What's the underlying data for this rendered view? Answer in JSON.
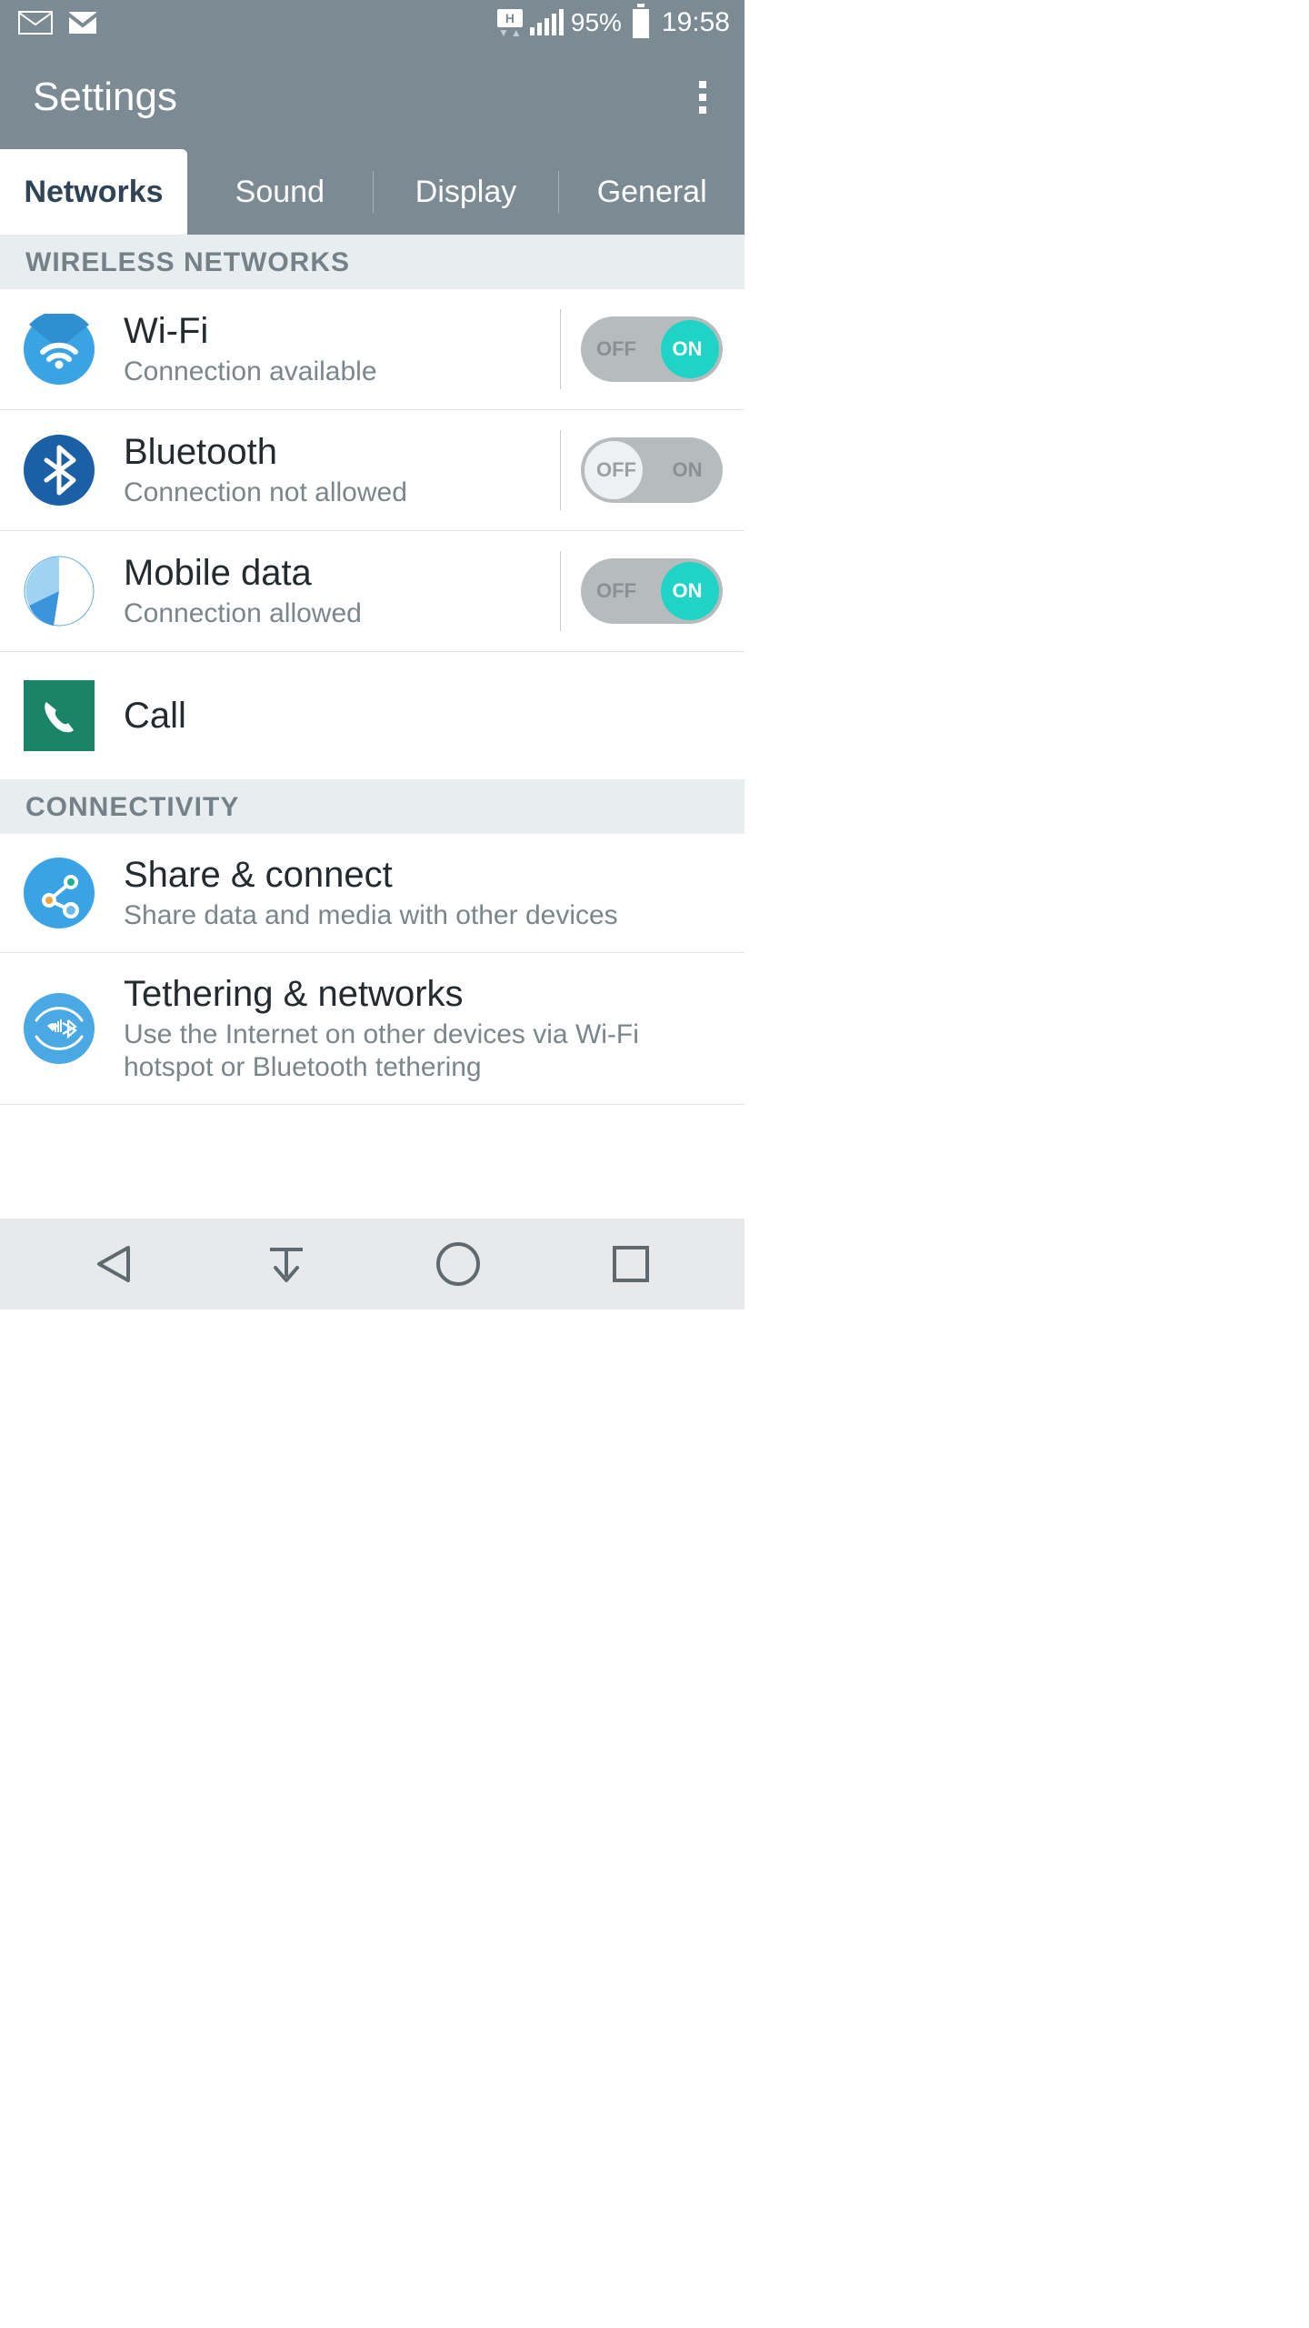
{
  "status": {
    "network_badge": "H",
    "battery_pct": "95%",
    "time": "19:58"
  },
  "header": {
    "title": "Settings"
  },
  "tabs": {
    "networks": "Networks",
    "sound": "Sound",
    "display": "Display",
    "general": "General"
  },
  "sections": {
    "wireless": "WIRELESS NETWORKS",
    "connectivity": "CONNECTIVITY"
  },
  "toggle_labels": {
    "off": "OFF",
    "on": "ON"
  },
  "items": {
    "wifi": {
      "title": "Wi-Fi",
      "sub": "Connection available",
      "on": true
    },
    "bluetooth": {
      "title": "Bluetooth",
      "sub": "Connection not allowed",
      "on": false
    },
    "mobiledata": {
      "title": "Mobile data",
      "sub": "Connection allowed",
      "on": true
    },
    "call": {
      "title": "Call"
    },
    "share": {
      "title": "Share & connect",
      "sub": "Share data and media with other devices"
    },
    "tether": {
      "title": "Tethering & networks",
      "sub": "Use the Internet on other devices via Wi-Fi hotspot or Bluetooth tethering"
    }
  }
}
